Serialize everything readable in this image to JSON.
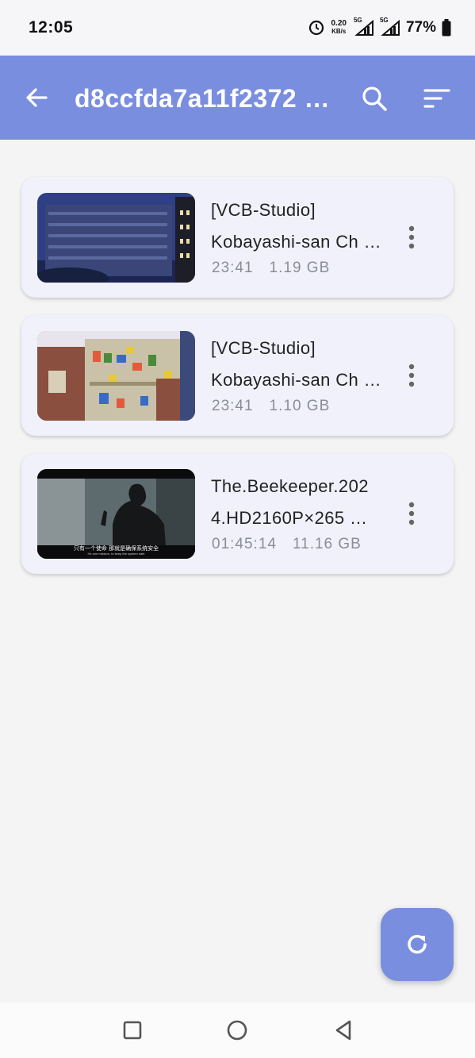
{
  "status_bar": {
    "time": "12:05",
    "net_speed_value": "0.20",
    "net_speed_unit": "KB/s",
    "signal_1": "5G",
    "signal_2": "5G",
    "battery": "77%",
    "icons": [
      "alarm-icon",
      "signal-5g-icon",
      "signal-5g-icon",
      "battery-icon"
    ]
  },
  "app_bar": {
    "title": "d8ccfda7a11f2372 …",
    "icons": [
      "back-arrow-icon",
      "search-icon",
      "sort-icon"
    ],
    "background": "#7a8ee0"
  },
  "videos": [
    {
      "title_line1": "[VCB-Studio]",
      "title_line2": "Kobayashi-san Ch …",
      "duration": "23:41",
      "size": "1.19 GB",
      "thumbnail": "building-night-thumbnail"
    },
    {
      "title_line1": "[VCB-Studio]",
      "title_line2": "Kobayashi-san Ch …",
      "duration": "23:41",
      "size": "1.10 GB",
      "thumbnail": "store-shelves-thumbnail"
    },
    {
      "title_line1": "The.Beekeeper.202",
      "title_line2": "4.HD2160P×265 …",
      "duration": "01:45:14",
      "size": "11.16 GB",
      "thumbnail": "movie-silhouette-thumbnail",
      "subtitle_cn": "只有一个使命 那就是确保系统安全",
      "subtitle_en": "It's one mission, to keep the system safe"
    }
  ],
  "fab": {
    "icon": "refresh-icon"
  },
  "nav_bar": {
    "icons": [
      "recents-square-icon",
      "home-circle-icon",
      "back-triangle-icon"
    ]
  }
}
